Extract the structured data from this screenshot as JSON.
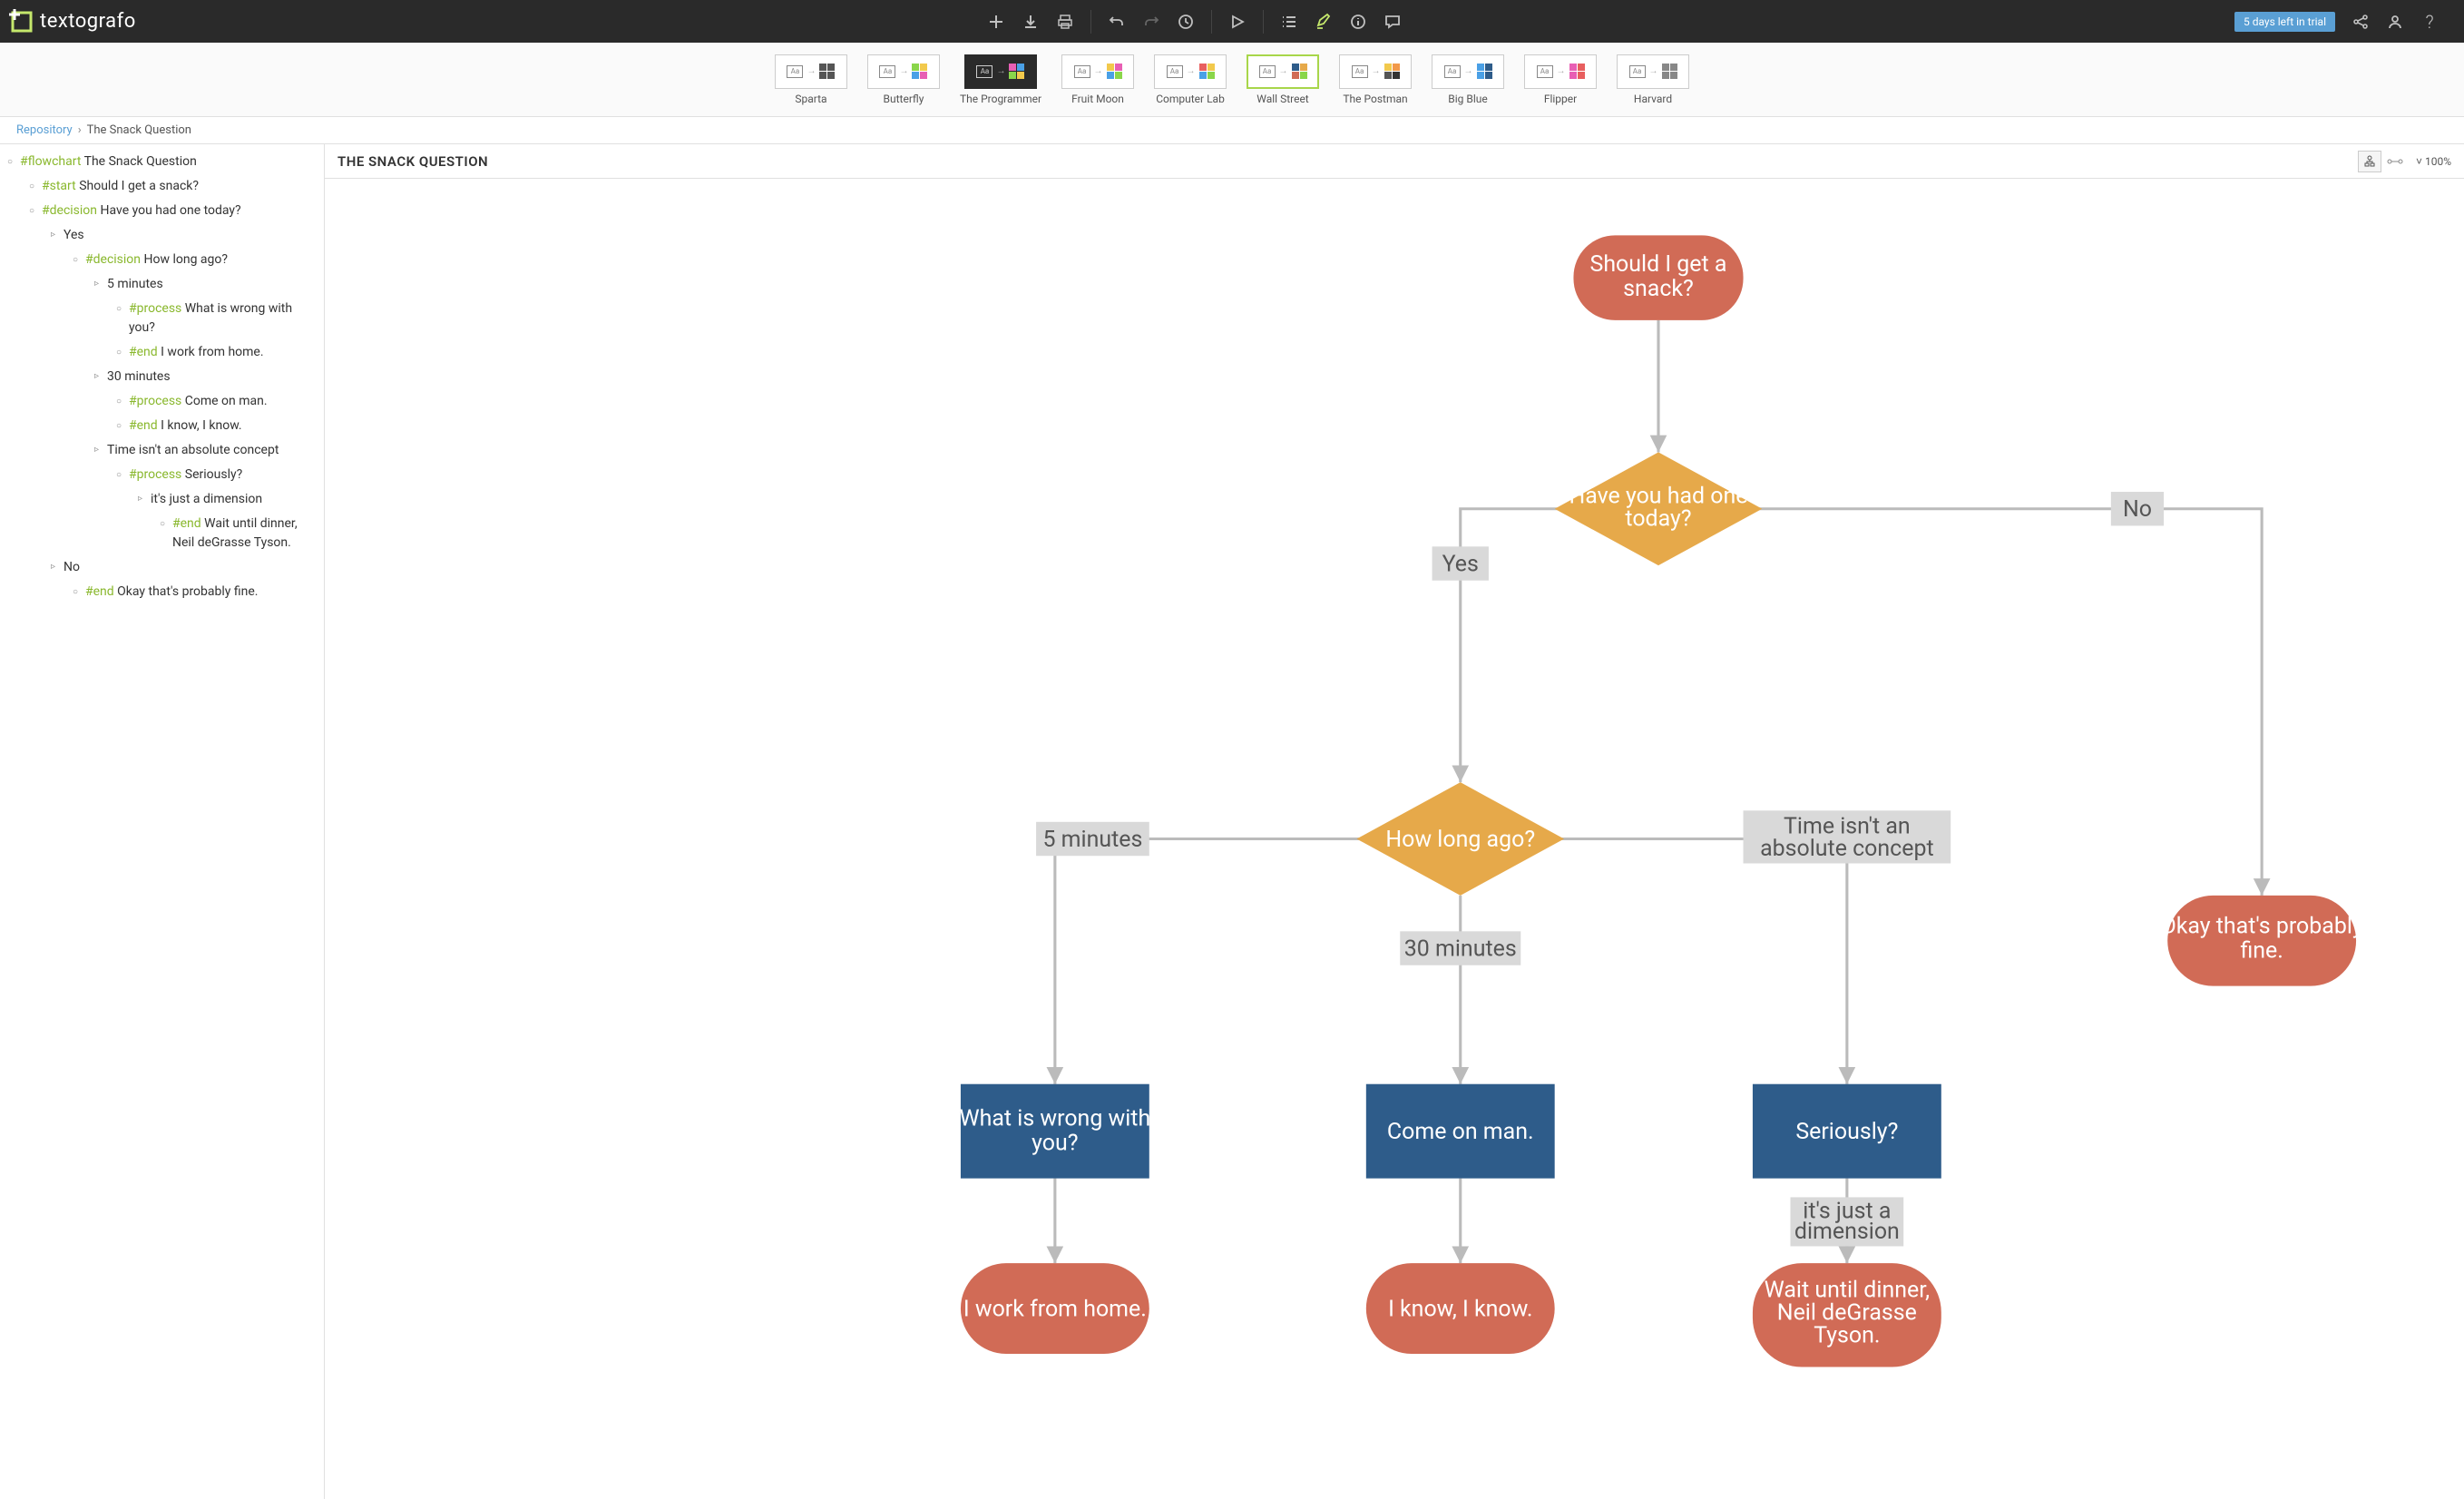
{
  "app": {
    "name": "textografo"
  },
  "trial": {
    "label": "5 days left in trial"
  },
  "themes": [
    {
      "label": "Sparta",
      "colors": [
        "#555",
        "#555",
        "#555",
        "#555"
      ]
    },
    {
      "label": "Butterfly",
      "colors": [
        "#8ad64a",
        "#f2c94c",
        "#4aa0e6",
        "#e85fb4"
      ]
    },
    {
      "label": "The Programmer",
      "dark": true,
      "colors": [
        "#e85fb4",
        "#4aa0e6",
        "#8ad64a",
        "#f2c94c"
      ]
    },
    {
      "label": "Fruit Moon",
      "colors": [
        "#f2c94c",
        "#e85fb4",
        "#4aa0e6",
        "#8ad64a"
      ]
    },
    {
      "label": "Computer Lab",
      "colors": [
        "#e85f5f",
        "#f2c94c",
        "#4aa0e6",
        "#8ad64a"
      ]
    },
    {
      "label": "Wall Street",
      "selected": true,
      "colors": [
        "#2e5c8a",
        "#e6a94a",
        "#d16b56",
        "#8ad64a"
      ]
    },
    {
      "label": "The Postman",
      "colors": [
        "#f2c94c",
        "#f2994a",
        "#555",
        "#333"
      ]
    },
    {
      "label": "Big Blue",
      "colors": [
        "#4aa0e6",
        "#2e5c8a",
        "#4aa0e6",
        "#2e5c8a"
      ]
    },
    {
      "label": "Flipper",
      "colors": [
        "#e85fb4",
        "#e85f5f",
        "#e85fb4",
        "#e85f5f"
      ]
    },
    {
      "label": "Harvard",
      "colors": [
        "#888",
        "#888",
        "#888",
        "#888"
      ]
    }
  ],
  "breadcrumb": {
    "root": "Repository",
    "current": "The Snack Question"
  },
  "canvas": {
    "title": "THE SNACK QUESTION",
    "zoom": "100%"
  },
  "outline": [
    {
      "indent": 0,
      "bullet": "o",
      "tag": "#flowchart",
      "text": "The Snack Question"
    },
    {
      "indent": 1,
      "bullet": "o",
      "tag": "#start",
      "text": "Should I get a snack?"
    },
    {
      "indent": 1,
      "bullet": "o",
      "tag": "#decision",
      "text": "Have you had one today?"
    },
    {
      "indent": 2,
      "bullet": ">",
      "text": "Yes"
    },
    {
      "indent": 3,
      "bullet": "o",
      "tag": "#decision",
      "text": "How long ago?"
    },
    {
      "indent": 4,
      "bullet": ">",
      "text": "5 minutes"
    },
    {
      "indent": 5,
      "bullet": "o",
      "tag": "#process",
      "text": " What is wrong with you?"
    },
    {
      "indent": 5,
      "bullet": "o",
      "tag": "#end",
      "text": "I work from home."
    },
    {
      "indent": 4,
      "bullet": ">",
      "text": "30 minutes"
    },
    {
      "indent": 5,
      "bullet": "o",
      "tag": "#process",
      "text": "Come on man."
    },
    {
      "indent": 5,
      "bullet": "o",
      "tag": "#end",
      "text": "I know, I know."
    },
    {
      "indent": 4,
      "bullet": ">",
      "text": "Time isn't an absolute concept"
    },
    {
      "indent": 5,
      "bullet": "o",
      "tag": "#process",
      "text": "Seriously?"
    },
    {
      "indent": 6,
      "bullet": ">",
      "text": "it's just a dimension"
    },
    {
      "indent": 7,
      "bullet": "o",
      "tag": "#end",
      "text": "Wait until dinner, Neil deGrasse Tyson."
    },
    {
      "indent": 2,
      "bullet": ">",
      "text": "No"
    },
    {
      "indent": 3,
      "bullet": "o",
      "tag": "#end",
      "text": "Okay that's probably fine."
    }
  ],
  "flowchart": {
    "nodes": {
      "start": "Should I get a snack?",
      "d1": "Have you had one today?",
      "yes": "Yes",
      "no": "No",
      "d2": "How long ago?",
      "l5": "5 minutes",
      "l30": "30 minutes",
      "ltime": "Time isn't an absolute concept",
      "p1": "What is wrong with you?",
      "p2": "Come on man.",
      "p3": "Seriously?",
      "ljust": "it's just a dimension",
      "e1": "I work from home.",
      "e2": "I know, I know.",
      "e3": "Wait until dinner, Neil deGrasse Tyson.",
      "e4": "Okay that's probably fine."
    }
  }
}
